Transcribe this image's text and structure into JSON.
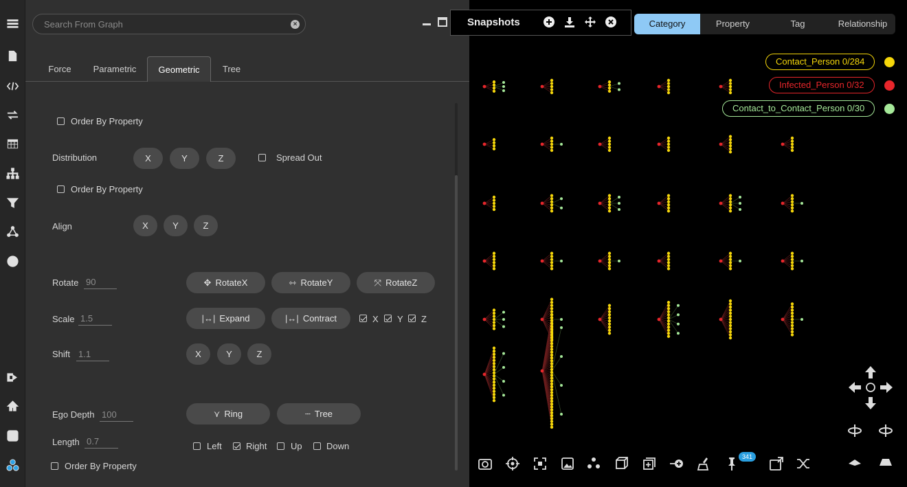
{
  "search": {
    "placeholder": "Search From Graph"
  },
  "tabs": [
    {
      "label": "Force"
    },
    {
      "label": "Parametric"
    },
    {
      "label": "Geometric"
    },
    {
      "label": "Tree"
    }
  ],
  "geometric": {
    "order_by_property": "Order By Property",
    "distribution_label": "Distribution",
    "spread_out": "Spread Out",
    "align_label": "Align",
    "axis_x": "X",
    "axis_y": "Y",
    "axis_z": "Z",
    "rotate_label": "Rotate",
    "rotate_value": "90",
    "rotate_x": "RotateX",
    "rotate_y": "RotateY",
    "rotate_z": "RotateZ",
    "scale_label": "Scale",
    "scale_value": "1.5",
    "expand": "Expand",
    "contract": "Contract",
    "shift_label": "Shift",
    "shift_value": "1.1",
    "ego_depth_label": "Ego Depth",
    "ego_depth_value": "100",
    "ring": "Ring",
    "tree": "Tree",
    "length_label": "Length",
    "length_value": "0.7",
    "left": "Left",
    "right": "Right",
    "up": "Up",
    "down": "Down"
  },
  "snapshots": {
    "title": "Snapshots"
  },
  "view_tabs": [
    {
      "label": "Category"
    },
    {
      "label": "Property"
    },
    {
      "label": "Tag"
    },
    {
      "label": "Relationship"
    }
  ],
  "legend": [
    {
      "label": "Contact_Person 0/284",
      "color": "#f5d60a"
    },
    {
      "label": "Infected_Person 0/32",
      "color": "#e8262b"
    },
    {
      "label": "Contact_to_Contact_Person 0/30",
      "color": "#a6e99a"
    }
  ],
  "toolbar_badge": "341",
  "colors": {
    "accent": "#8ec9f5",
    "panel": "#303030",
    "node_yellow": "#f5d60a",
    "node_red": "#e8262b",
    "node_green": "#a6e99a"
  }
}
